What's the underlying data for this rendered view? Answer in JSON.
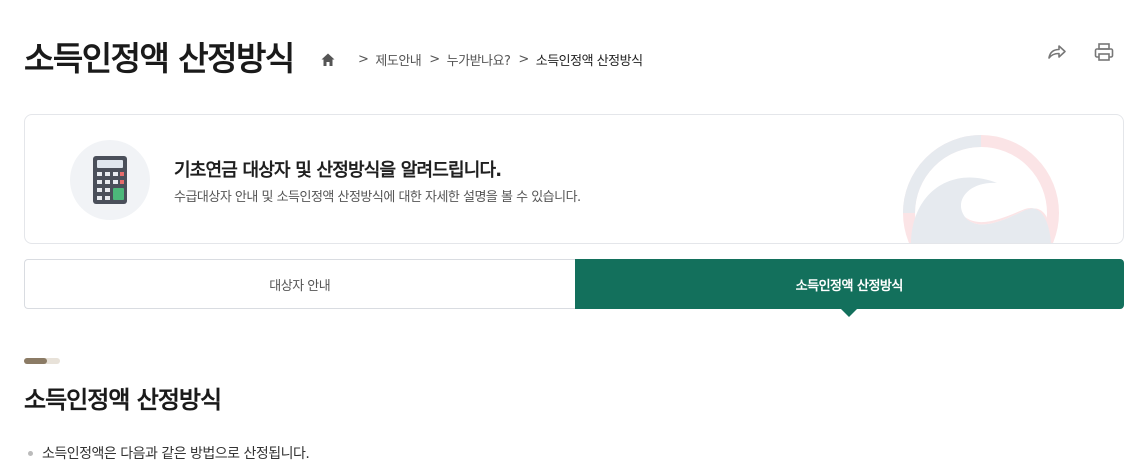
{
  "page": {
    "title": "소득인정액 산정방식"
  },
  "breadcrumb": {
    "home_icon": "home-icon",
    "items": [
      "제도안내",
      "누가받나요?",
      "소득인정액 산정방식"
    ],
    "separator": ">"
  },
  "tools": {
    "share_icon": "share-icon",
    "print_icon": "print-icon"
  },
  "intro": {
    "icon": "calculator-icon",
    "title": "기초연금 대상자 및 산정방식을 알려드립니다.",
    "subtitle": "수급대상자 안내 및 소득인정액 산정방식에 대한 자세한 설명을 볼 수 있습니다."
  },
  "tabs": [
    {
      "label": "대상자 안내",
      "active": false
    },
    {
      "label": "소득인정액 산정방식",
      "active": true
    }
  ],
  "section": {
    "title": "소득인정액 산정방식",
    "bullets": [
      "소득인정액은 다음과 같은 방법으로 산정됩니다."
    ]
  },
  "colors": {
    "accent": "#13705c",
    "section_bar": "#8b7b65"
  }
}
